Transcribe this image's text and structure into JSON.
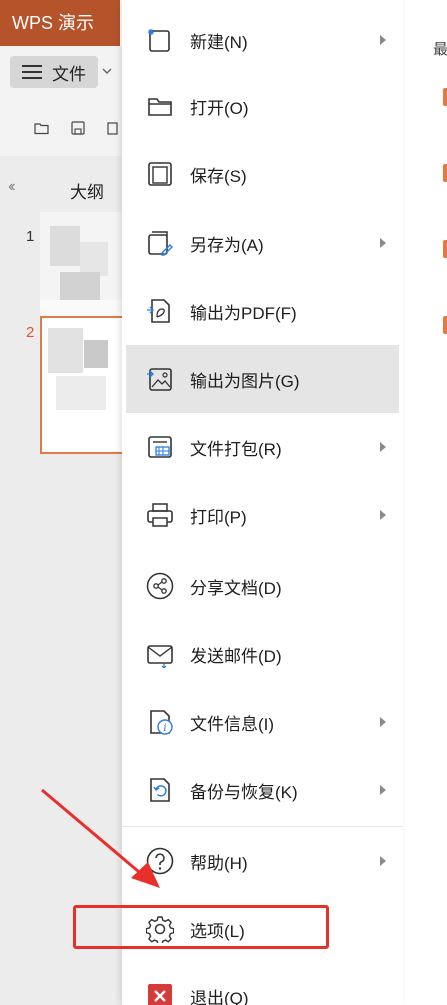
{
  "app": {
    "title": "WPS 演示"
  },
  "toolbar": {
    "file_label": "文件"
  },
  "panel": {
    "outline_tab": "大纲",
    "slides": [
      {
        "num": "1"
      },
      {
        "num": "2"
      }
    ]
  },
  "right": {
    "recent_label": "最"
  },
  "menu": {
    "items": [
      {
        "label": "新建(N)",
        "icon": "new-icon",
        "submenu": true
      },
      {
        "label": "打开(O)",
        "icon": "folder-icon",
        "submenu": false
      },
      {
        "label": "保存(S)",
        "icon": "save-icon",
        "submenu": false
      },
      {
        "label": "另存为(A)",
        "icon": "save-as-icon",
        "submenu": true
      },
      {
        "label": "输出为PDF(F)",
        "icon": "pdf-icon",
        "submenu": false
      },
      {
        "label": "输出为图片(G)",
        "icon": "image-icon",
        "submenu": false
      },
      {
        "label": "文件打包(R)",
        "icon": "package-icon",
        "submenu": true
      },
      {
        "label": "打印(P)",
        "icon": "print-icon",
        "submenu": true
      },
      {
        "label": "分享文档(D)",
        "icon": "share-icon",
        "submenu": false
      },
      {
        "label": "发送邮件(D)",
        "icon": "mail-icon",
        "submenu": false
      },
      {
        "label": "文件信息(I)",
        "icon": "info-icon",
        "submenu": true
      },
      {
        "label": "备份与恢复(K)",
        "icon": "backup-icon",
        "submenu": true
      },
      {
        "label": "帮助(H)",
        "icon": "help-icon",
        "submenu": true
      },
      {
        "label": "选项(L)",
        "icon": "gear-icon",
        "submenu": false
      },
      {
        "label": "退出(Q)",
        "icon": "exit-icon",
        "submenu": false
      }
    ]
  },
  "colors": {
    "accent": "#b5532b",
    "highlight": "#e8302b",
    "hover": "#e5e5e5"
  }
}
